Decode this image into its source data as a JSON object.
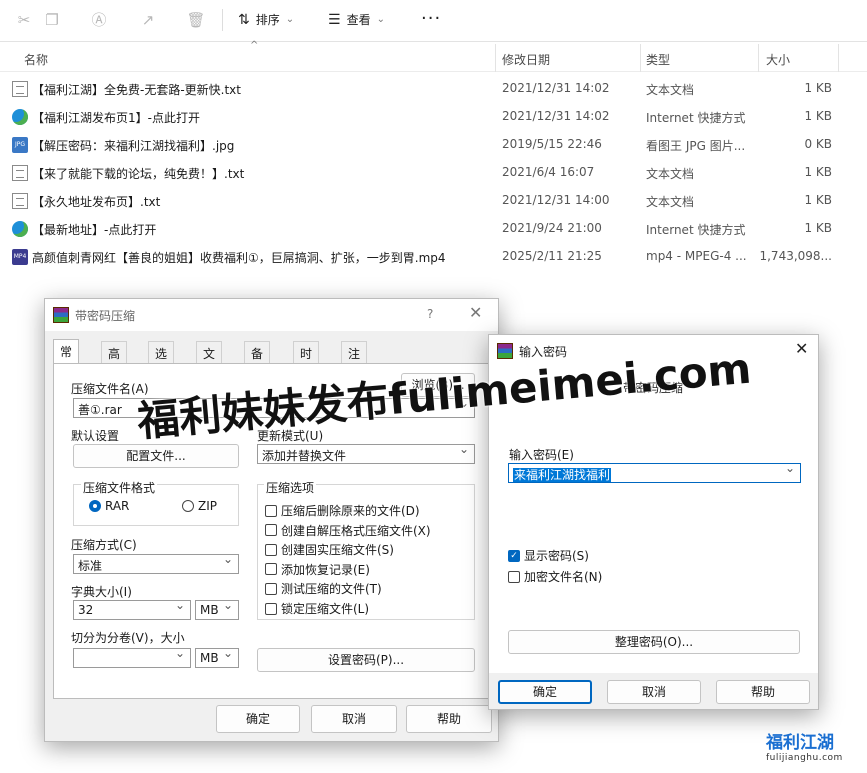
{
  "toolbar": {
    "sort_label": "排序",
    "view_label": "查看",
    "more_label": "···"
  },
  "columns": {
    "name": "名称",
    "date": "修改日期",
    "type": "类型",
    "size": "大小"
  },
  "files": [
    {
      "icon": "txt-file-icon",
      "name": "【福利江湖】全免费-无套路-更新快.txt",
      "date": "2021/12/31 14:02",
      "type": "文本文档",
      "size": "1 KB"
    },
    {
      "icon": "internet-shortcut-icon",
      "name": "【福利江湖发布页1】-点此打开",
      "date": "2021/12/31 14:02",
      "type": "Internet 快捷方式",
      "size": "1 KB"
    },
    {
      "icon": "jpg-file-icon",
      "name": "【解压密码：来福利江湖找福利】.jpg",
      "date": "2019/5/15 22:46",
      "type": "看图王 JPG 图片...",
      "size": "0 KB"
    },
    {
      "icon": "txt-file-icon",
      "name": "【来了就能下载的论坛，纯免费！】.txt",
      "date": "2021/6/4 16:07",
      "type": "文本文档",
      "size": "1 KB"
    },
    {
      "icon": "txt-file-icon",
      "name": "【永久地址发布页】.txt",
      "date": "2021/12/31 14:00",
      "type": "文本文档",
      "size": "1 KB"
    },
    {
      "icon": "internet-shortcut-icon",
      "name": "【最新地址】-点此打开",
      "date": "2021/9/24 21:00",
      "type": "Internet 快捷方式",
      "size": "1 KB"
    },
    {
      "icon": "mp4-file-icon",
      "name": "高颜值刺青网红【善良的姐姐】收费福利①，巨屌搞洞、扩张，一步到胃.mp4",
      "date": "2025/2/11 21:25",
      "type": "mp4 - MPEG-4 ...",
      "size": "1,743,098..."
    }
  ],
  "archive_dialog": {
    "title": "带密码压缩",
    "help": "?",
    "tabs": [
      "常规",
      "高级",
      "选项",
      "文件",
      "备份",
      "时间",
      "注释"
    ],
    "archive_name_label": "压缩文件名(A)",
    "browse_label": "浏览(B)...",
    "archive_name_value": "善①.rar",
    "default_settings_label": "默认设置",
    "profiles_label": "配置文件...",
    "update_mode_label": "更新模式(U)",
    "update_mode_value": "添加并替换文件",
    "format_group_label": "压缩文件格式",
    "format_rar": "RAR",
    "format_zip": "ZIP",
    "method_label": "压缩方式(C)",
    "method_value": "标准",
    "dict_label": "字典大小(I)",
    "dict_value": "32",
    "dict_unit": "MB",
    "split_label": "切分为分卷(V)，大小",
    "split_value": "",
    "split_unit": "MB",
    "options_group_label": "压缩选项",
    "options": [
      {
        "label": "压缩后删除原来的文件(D)",
        "checked": false
      },
      {
        "label": "创建自解压格式压缩文件(X)",
        "checked": false
      },
      {
        "label": "创建固实压缩文件(S)",
        "checked": false
      },
      {
        "label": "添加恢复记录(E)",
        "checked": false
      },
      {
        "label": "测试压缩的文件(T)",
        "checked": false
      },
      {
        "label": "锁定压缩文件(L)",
        "checked": false
      }
    ],
    "set_password_label": "设置密码(P)...",
    "ok_label": "确定",
    "cancel_label": "取消",
    "help_label": "帮助"
  },
  "password_dialog": {
    "title": "输入密码",
    "heading": "带密码压缩",
    "password_label": "输入密码(E)",
    "password_value": "来福利江湖找福利",
    "show_password_label": "显示密码(S)",
    "show_password_checked": true,
    "encrypt_names_label": "加密文件名(N)",
    "encrypt_names_checked": false,
    "organize_label": "整理密码(O)...",
    "ok_label": "确定",
    "cancel_label": "取消",
    "help_label": "帮助"
  },
  "watermark": {
    "text": "福利妹妹发布fulimeimei.com"
  },
  "corner_logo": {
    "title": "福利江湖",
    "url": "fulijianghu.com"
  },
  "colors": {
    "accent": "#0067c0",
    "selection": "#0078d7"
  }
}
